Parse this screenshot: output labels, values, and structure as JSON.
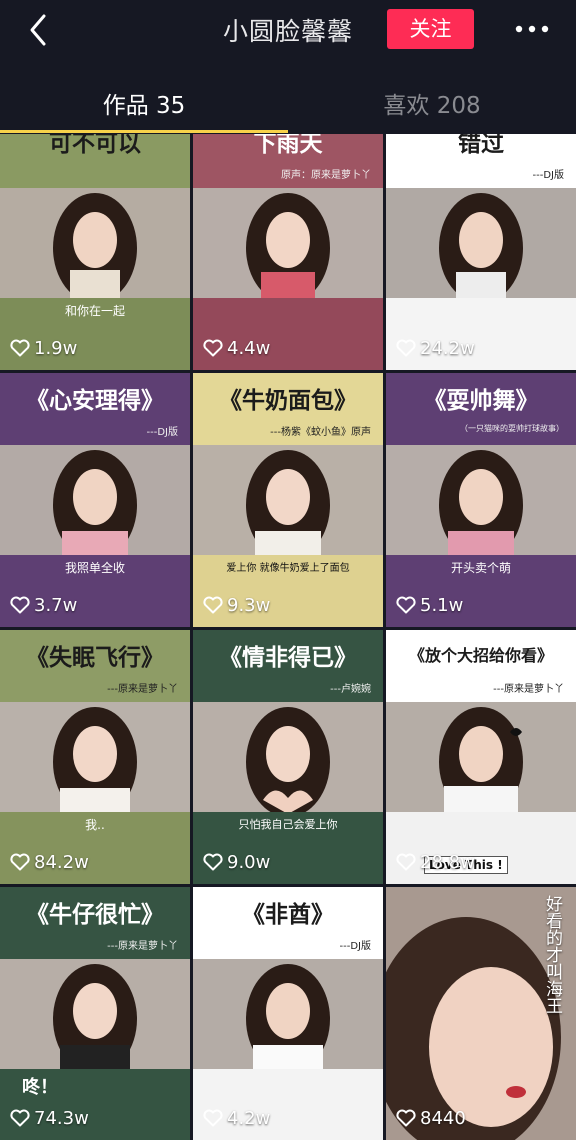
{
  "header": {
    "title": "小圆脸馨馨",
    "follow_label": "关注"
  },
  "tabs": [
    {
      "label": "作品 35",
      "active": true
    },
    {
      "label": "喜欢 208",
      "active": false
    }
  ],
  "colors": {
    "background": "#161823",
    "accent": "#fe2c55",
    "tab_indicator": "#f7d24a"
  },
  "videos": [
    {
      "title": "可不可以",
      "subtitle": "",
      "caption": "和你在一起",
      "likes": "1.9w"
    },
    {
      "title": "下雨天",
      "subtitle": "原声：原来是萝卜丫",
      "caption": "",
      "likes": "4.4w"
    },
    {
      "title": "错过",
      "subtitle": "---DJ版",
      "caption": "",
      "likes": "24.2w"
    },
    {
      "title": "《心安理得》",
      "subtitle": "---DJ版",
      "caption": "我照单全收",
      "likes": "3.7w"
    },
    {
      "title": "《牛奶面包》",
      "subtitle": "---杨紫《蚊小鱼》原声",
      "caption": "爱上你 就像牛奶爱上了面包",
      "likes": "9.3w"
    },
    {
      "title": "《耍帅舞》",
      "subtitle": "（一只猫咪的耍帅打球故事）",
      "caption": "开头卖个萌",
      "likes": "5.1w"
    },
    {
      "title": "《失眠飞行》",
      "subtitle": "---原来是萝卜丫",
      "caption": "我..",
      "likes": "84.2w"
    },
    {
      "title": "《情非得已》",
      "subtitle": "---卢婉婉",
      "caption": "只怕我自己会爱上你",
      "likes": "9.0w"
    },
    {
      "title": "《放个大招给你看》",
      "subtitle": "---原来是萝卜丫",
      "caption": "Love This !",
      "likes": "28.8w"
    },
    {
      "title": "《牛仔很忙》",
      "subtitle": "---原来是萝卜丫",
      "caption": "咚！",
      "likes": "74.3w"
    },
    {
      "title": "《非酋》",
      "subtitle": "---DJ版",
      "caption": "",
      "likes": "4.2w"
    },
    {
      "title": "好看的才叫海王",
      "subtitle": "",
      "caption": "",
      "likes": "8440"
    }
  ]
}
